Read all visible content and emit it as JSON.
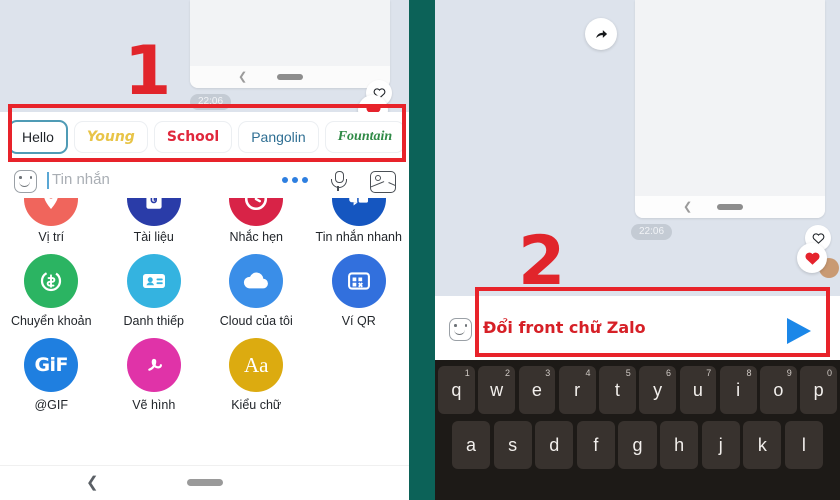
{
  "colors": {
    "annotation_red": "#e8232a",
    "chat_background": "#dde3ec",
    "divider_teal": "#0c6258",
    "send_blue": "#1b87e8",
    "selected_chip_border": "#4f9bb5",
    "keyboard_background": "#1d1a17",
    "key_background": "#38322e"
  },
  "left_panel": {
    "annotation_number": "1",
    "timestamp": "22:06",
    "reaction_heart_outline_icon": "heart-outline-icon",
    "reaction_heart_filled_icon": "heart-filled-icon",
    "font_chips": [
      {
        "label": "Hello",
        "style": "default",
        "color": "#1f2328",
        "selected": true
      },
      {
        "label": "Young",
        "style": "italic-bold",
        "color": "#e8c447",
        "selected": false
      },
      {
        "label": "School",
        "style": "bold",
        "color": "#e0283c",
        "selected": false
      },
      {
        "label": "Pangolin",
        "style": "default",
        "color": "#2f6f93",
        "selected": false
      },
      {
        "label": "Fountain",
        "style": "serif-italic",
        "color": "#2f8a46",
        "selected": false
      }
    ],
    "message_bar": {
      "emoji_icon": "emoji-face-icon",
      "placeholder": "Tin nhắn",
      "more_icon": "more-dots-icon",
      "mic_icon": "microphone-icon",
      "image_icon": "image-picker-icon"
    },
    "attachments": [
      {
        "label": "Vị trí",
        "icon": "location-icon",
        "color": "#f0655c",
        "glyph": "V"
      },
      {
        "label": "Tài liệu",
        "icon": "document-icon",
        "color": "#2a3ca8",
        "glyph": "D"
      },
      {
        "label": "Nhắc hẹn",
        "icon": "reminder-icon",
        "color": "#d82347",
        "glyph": "R"
      },
      {
        "label": "Tin nhắn nhanh",
        "icon": "quick-message-icon",
        "color": "#1556c0",
        "glyph": "Q"
      },
      {
        "label": "Chuyển khoản",
        "icon": "money-transfer-icon",
        "color": "#2bb462",
        "glyph": "$"
      },
      {
        "label": "Danh thiếp",
        "icon": "contact-card-icon",
        "color": "#34b3e0",
        "glyph": "C"
      },
      {
        "label": "Cloud của tôi",
        "icon": "cloud-icon",
        "color": "#3a8ee8",
        "glyph": "☁"
      },
      {
        "label": "Ví QR",
        "icon": "qr-wallet-icon",
        "color": "#3270dd",
        "glyph": "QR"
      },
      {
        "label": "@GIF",
        "icon": "gif-icon",
        "color": "#1f7fe0",
        "glyph": "GIF"
      },
      {
        "label": "Vẽ hình",
        "icon": "draw-icon",
        "color": "#e033a8",
        "glyph": "✎"
      },
      {
        "label": "Kiểu chữ",
        "icon": "text-style-icon",
        "color": "#dcab10",
        "glyph": "Aa"
      }
    ],
    "system_nav": {
      "back_icon": "back-chevron-icon",
      "home_icon": "home-pill-icon"
    }
  },
  "right_panel": {
    "annotation_number": "2",
    "timestamp": "22:06",
    "share_icon": "share-forward-icon",
    "reaction_heart_outline_icon": "heart-outline-icon",
    "reaction_heart_filled_icon": "heart-filled-icon",
    "avatar_icon": "avatar-icon",
    "input": {
      "emoji_icon": "emoji-face-icon",
      "value": "Đổi front chữ Zalo",
      "send_icon": "send-arrow-icon"
    },
    "keyboard": {
      "row1": [
        {
          "key": "q",
          "num": "1"
        },
        {
          "key": "w",
          "num": "2"
        },
        {
          "key": "e",
          "num": "3"
        },
        {
          "key": "r",
          "num": "4"
        },
        {
          "key": "t",
          "num": "5"
        },
        {
          "key": "y",
          "num": "6"
        },
        {
          "key": "u",
          "num": "7"
        },
        {
          "key": "i",
          "num": "8"
        },
        {
          "key": "o",
          "num": "9"
        },
        {
          "key": "p",
          "num": "0"
        }
      ],
      "row2": [
        {
          "key": "a",
          "num": ""
        },
        {
          "key": "s",
          "num": ""
        },
        {
          "key": "d",
          "num": ""
        },
        {
          "key": "f",
          "num": ""
        },
        {
          "key": "g",
          "num": ""
        },
        {
          "key": "h",
          "num": ""
        },
        {
          "key": "j",
          "num": ""
        },
        {
          "key": "k",
          "num": ""
        },
        {
          "key": "l",
          "num": ""
        }
      ]
    }
  }
}
